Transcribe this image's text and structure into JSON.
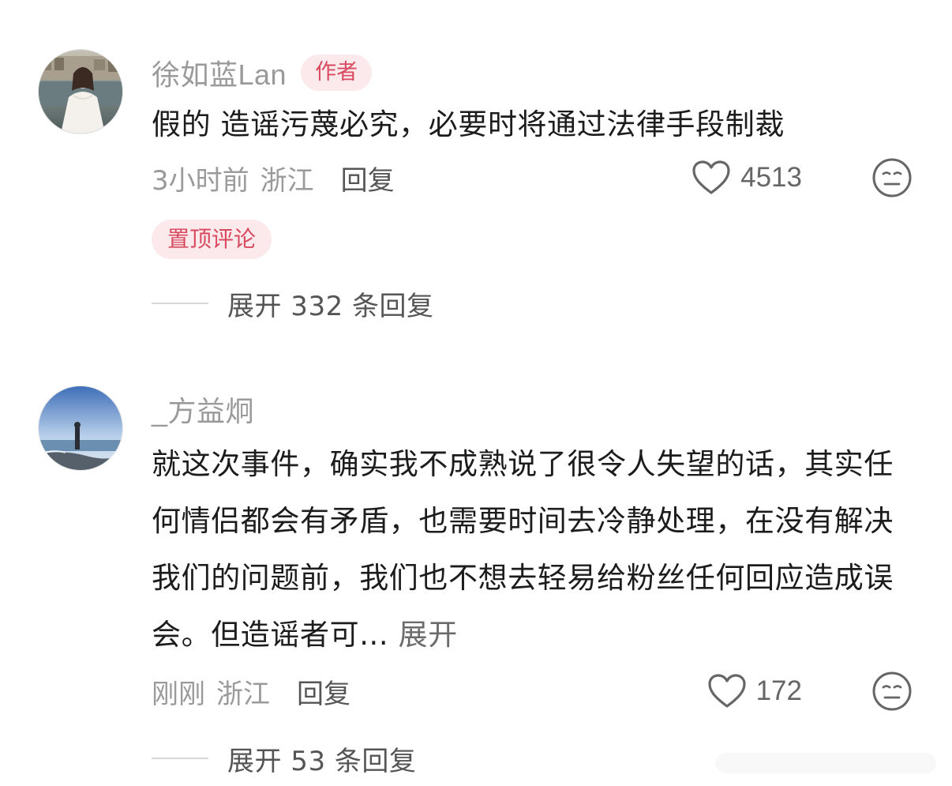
{
  "comments": [
    {
      "username": "徐如蓝Lan",
      "author_badge": "作者",
      "text": "假的 造谣污蔑必究，必要时将通过法律手段制裁",
      "time": "3小时前",
      "location": "浙江",
      "reply_label": "回复",
      "likes": "4513",
      "pinned_label": "置顶评论",
      "expand_replies": "展开 332 条回复",
      "avatar_icon": "woman-white-dress-photo"
    },
    {
      "username": "_方益炯",
      "text": "就这次事件，确实我不成熟说了很令人失望的话，其实任何情侣都会有矛盾，也需要时间去冷静处理，在没有解决我们的问题前，我们也不想去轻易给粉丝任何回应造成误会。但造谣者可...",
      "expand_text": "展开",
      "time": "刚刚",
      "location": "浙江",
      "reply_label": "回复",
      "likes": "172",
      "expand_replies": "展开 53 条回复",
      "avatar_icon": "seaside-person-photo"
    }
  ],
  "icons": {
    "like": "heart-outline-icon",
    "dislike": "meh-face-icon"
  },
  "colors": {
    "badge_bg": "#fbe9ec",
    "badge_text": "#d84a5f",
    "muted_text": "#9a9a9a"
  }
}
